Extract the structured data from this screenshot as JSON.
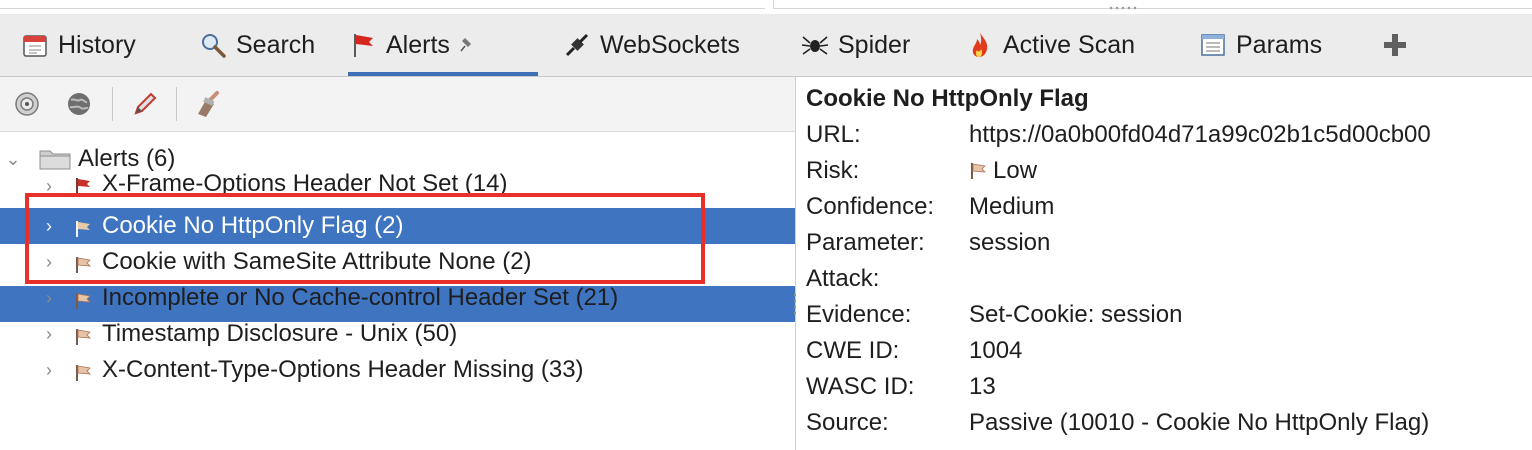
{
  "tabs": [
    {
      "label": "History",
      "icon": "calendar-icon"
    },
    {
      "label": "Search",
      "icon": "magnifier-icon"
    },
    {
      "label": "Alerts",
      "icon": "red-flag-icon"
    },
    {
      "label": "WebSockets",
      "icon": "plug-icon"
    },
    {
      "label": "Spider",
      "icon": "spider-icon"
    },
    {
      "label": "Active Scan",
      "icon": "flame-icon"
    },
    {
      "label": "Params",
      "icon": "list-icon"
    }
  ],
  "active_tab": "Alerts",
  "tree": {
    "root_label": "Alerts (6)",
    "items": [
      {
        "label": "X-Frame-Options Header Not Set (14)",
        "risk": "Medium"
      },
      {
        "label": "Cookie No HttpOnly Flag (2)",
        "risk": "Low",
        "selected": true
      },
      {
        "label": "Cookie with SameSite Attribute None (2)",
        "risk": "Low"
      },
      {
        "label": "Incomplete or No Cache-control Header Set (21)",
        "risk": "Low"
      },
      {
        "label": "Timestamp Disclosure - Unix (50)",
        "risk": "Low"
      },
      {
        "label": "X-Content-Type-Options Header Missing (33)",
        "risk": "Low"
      }
    ]
  },
  "detail": {
    "title": "Cookie No HttpOnly Flag",
    "fields": [
      {
        "key": "URL:",
        "value": "https://0a0b00fd04d71a99c02b1c5d00cb00"
      },
      {
        "key": "Risk:",
        "value": "Low"
      },
      {
        "key": "Confidence:",
        "value": "Medium"
      },
      {
        "key": "Parameter:",
        "value": "session"
      },
      {
        "key": "Attack:",
        "value": ""
      },
      {
        "key": "Evidence:",
        "value": "Set-Cookie: session"
      },
      {
        "key": "CWE ID:",
        "value": "1004"
      },
      {
        "key": "WASC ID:",
        "value": "13"
      },
      {
        "key": "Source:",
        "value": "Passive (10010 - Cookie No HttpOnly Flag)"
      }
    ]
  },
  "colors": {
    "selection": "#3e74c0",
    "highlight_box": "#e8302a",
    "tab_underline": "#3d6fb6"
  }
}
